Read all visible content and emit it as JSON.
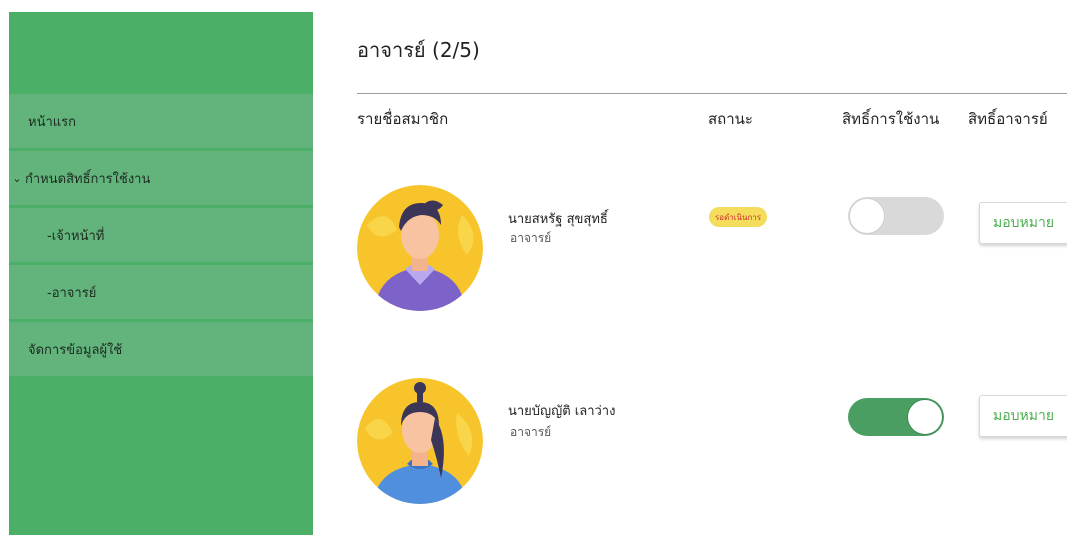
{
  "sidebar": {
    "items": [
      {
        "label": "หน้าแรก"
      },
      {
        "label": "กำหนดสิทธิ์การใช้งาน",
        "caret": "⌄"
      },
      {
        "label": "-เจ้าหน้าที่"
      },
      {
        "label": "-อาจารย์"
      },
      {
        "label": "จัดการข้อมูลผู้ใช้"
      }
    ]
  },
  "page": {
    "title": "อาจารย์ (2/5)"
  },
  "table": {
    "headers": [
      "รายชื่อสมาชิก",
      "สถานะ",
      "สิทธิ์การใช้งาน",
      "สิทธิ์อาจารย์"
    ]
  },
  "members": [
    {
      "name": "นายสหรัฐ สุขสุทธิ์",
      "role": "อาจารย์",
      "status": "รอดำเนินการ",
      "access_enabled": false,
      "assign_label": "มอบหมาย"
    },
    {
      "name": "นายบัญญัติ เลาว่าง",
      "role": "อาจารย์",
      "status": "",
      "access_enabled": true,
      "assign_label": "มอบหมาย"
    }
  ],
  "colors": {
    "sidebar": "#4caf68",
    "menu_item": "#62b37c",
    "toggle_on": "#4a9e62",
    "toggle_off": "#d9d9d9",
    "badge_bg": "#f4dc5c",
    "badge_text": "#d32f2f",
    "assign_text": "#4caf50"
  }
}
